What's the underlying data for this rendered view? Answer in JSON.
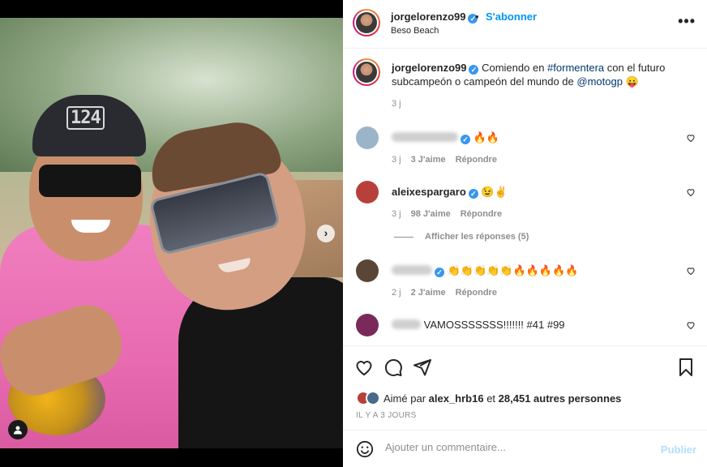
{
  "post": {
    "username": "jorgelorenzo99",
    "separator": "•",
    "follow_label": "S'abonner",
    "location": "Beso Beach",
    "more_label": "•••",
    "cap_logo_text": "124",
    "caption": {
      "lead": "Comiendo en ",
      "hashtag": "#formentera",
      "middle": " con el futuro subcampeón o campeón del mundo de ",
      "mention": "@motogp",
      "emoji": "😛",
      "time": "3 j"
    }
  },
  "comments": [
    {
      "username": "",
      "text": "🔥🔥",
      "time": "3 j",
      "likes": "3 J'aime",
      "reply_label": "Répondre",
      "avatar_color": "#9bb4c8"
    },
    {
      "username": "aleixespargaro",
      "text": "😉✌",
      "time": "3 j",
      "likes": "98 J'aime",
      "reply_label": "Répondre",
      "avatar_color": "#b8403a"
    },
    {
      "username": "",
      "text": "👏👏👏👏👏🔥🔥🔥🔥🔥",
      "time": "2 j",
      "likes": "2 J'aime",
      "reply_label": "Répondre",
      "avatar_color": "#5a4636"
    },
    {
      "username": "",
      "text": "VAMOSSSSSSS!!!!!!! #41 #99",
      "time": "",
      "likes": "",
      "reply_label": "",
      "avatar_color": "#7a2a5a"
    }
  ],
  "view_replies": "Afficher les réponses (5)",
  "likes": {
    "prefix": "Aimé par ",
    "user": "alex_hrb16",
    "middle": " et ",
    "count": "28,451 autres personnes"
  },
  "posted_ago": "IL Y A 3 JOURS",
  "add_comment": {
    "placeholder": "Ajouter un commentaire...",
    "post_label": "Publier"
  },
  "icons": {
    "more": "more-horizontal-icon",
    "like": "heart-icon",
    "comment": "comment-icon",
    "share": "send-icon",
    "save": "bookmark-icon",
    "emoji": "smiley-icon",
    "verified": "verified-badge-icon",
    "next": "chevron-right-icon",
    "tagged_users": "user-tag-icon"
  },
  "colors": {
    "link": "#00376b",
    "follow": "#0095f6",
    "verified": "#3897f0",
    "post_disabled": "#b2dffc"
  }
}
